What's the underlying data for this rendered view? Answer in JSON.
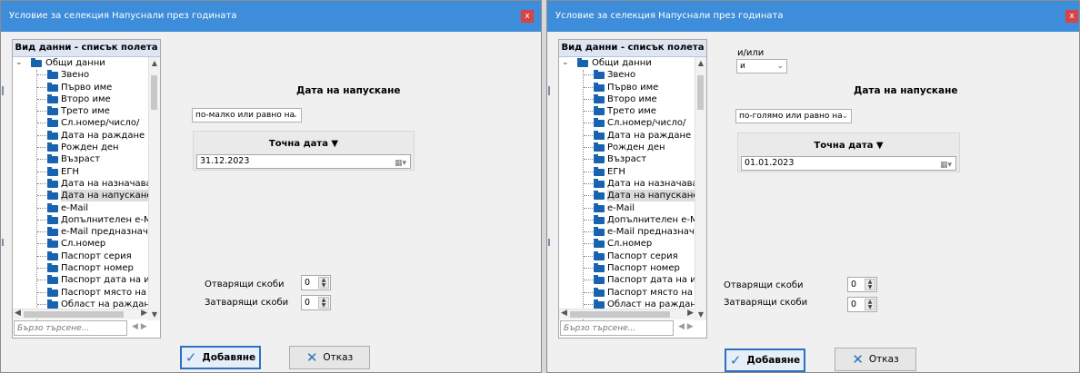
{
  "windows": [
    {
      "title": "Условие за селекция Напуснали през годината",
      "close_glyph": "x",
      "panel_header": "Вид данни - списък полета",
      "tree": [
        {
          "label": "Общи данни",
          "level": 0
        },
        {
          "label": "Звено",
          "level": 1
        },
        {
          "label": "Първо име",
          "level": 1
        },
        {
          "label": "Второ име",
          "level": 1
        },
        {
          "label": "Трето име",
          "level": 1
        },
        {
          "label": "Сл.номер/число/",
          "level": 1
        },
        {
          "label": "Дата на раждане",
          "level": 1
        },
        {
          "label": "Рожден ден",
          "level": 1
        },
        {
          "label": "Възраст",
          "level": 1
        },
        {
          "label": "ЕГН",
          "level": 1
        },
        {
          "label": "Дата на назначаване",
          "level": 1
        },
        {
          "label": "Дата на напускане",
          "level": 1,
          "selected": true
        },
        {
          "label": "e-Mail",
          "level": 1
        },
        {
          "label": "Допълнителен e-Mail",
          "level": 1
        },
        {
          "label": "e-Mail предназначение",
          "level": 1
        },
        {
          "label": "Сл.номер",
          "level": 1
        },
        {
          "label": "Паспорт серия",
          "level": 1
        },
        {
          "label": "Паспорт номер",
          "level": 1
        },
        {
          "label": "Паспорт дата на издав",
          "level": 1
        },
        {
          "label": "Паспорт място на изд",
          "level": 1
        },
        {
          "label": "Област на раждане",
          "level": 1
        }
      ],
      "search_placeholder": "Бързо търсене...",
      "search_nav": "◀ ▶",
      "andor_label": "",
      "andor_value": "",
      "condition_title": "Дата на напускане",
      "operator": "по-малко или равно на",
      "date_header": "Точна дата ▼",
      "date_value": "31.12.2023",
      "open_brackets_label": "Отварящи скоби",
      "open_brackets_value": "0",
      "close_brackets_label": "Затварящи скоби",
      "close_brackets_value": "0",
      "add_button": "Добавяне",
      "cancel_button": "Отказ"
    },
    {
      "title": "Условие за селекция Напуснали през годината",
      "close_glyph": "x",
      "panel_header": "Вид данни - списък полета",
      "tree": [
        {
          "label": "Общи данни",
          "level": 0
        },
        {
          "label": "Звено",
          "level": 1
        },
        {
          "label": "Първо име",
          "level": 1
        },
        {
          "label": "Второ име",
          "level": 1
        },
        {
          "label": "Трето име",
          "level": 1
        },
        {
          "label": "Сл.номер/число/",
          "level": 1
        },
        {
          "label": "Дата на раждане",
          "level": 1
        },
        {
          "label": "Рожден ден",
          "level": 1
        },
        {
          "label": "Възраст",
          "level": 1
        },
        {
          "label": "ЕГН",
          "level": 1
        },
        {
          "label": "Дата на назначаване",
          "level": 1
        },
        {
          "label": "Дата на напускане",
          "level": 1,
          "selected": true
        },
        {
          "label": "e-Mail",
          "level": 1
        },
        {
          "label": "Допълнителен e-Mail",
          "level": 1
        },
        {
          "label": "e-Mail предназначение",
          "level": 1
        },
        {
          "label": "Сл.номер",
          "level": 1
        },
        {
          "label": "Паспорт серия",
          "level": 1
        },
        {
          "label": "Паспорт номер",
          "level": 1
        },
        {
          "label": "Паспорт дата на издав",
          "level": 1
        },
        {
          "label": "Паспорт място на изд",
          "level": 1
        },
        {
          "label": "Област на раждане",
          "level": 1
        }
      ],
      "search_placeholder": "Бързо търсене...",
      "search_nav": "◀ ▶",
      "andor_label": "и/или",
      "andor_value": "и",
      "condition_title": "Дата на напускане",
      "operator": "по-голямо или равно на",
      "date_header": "Точна дата ▼",
      "date_value": "01.01.2023",
      "open_brackets_label": "Отварящи скоби",
      "open_brackets_value": "0",
      "close_brackets_label": "Затварящи скоби",
      "close_brackets_value": "0",
      "add_button": "Добавяне",
      "cancel_button": "Отказ"
    }
  ],
  "colors": {
    "titlebar": "#3d8ddb",
    "close_button": "#d64545",
    "folder": "#1763b0",
    "primary_border": "#2f6fbf"
  },
  "icons": {
    "folder": "folder-icon",
    "check": "check-icon",
    "cross": "x-icon",
    "calendar": "calendar-icon",
    "spin": "spinner-arrows-icon",
    "chevron": "chevron-down-icon"
  }
}
